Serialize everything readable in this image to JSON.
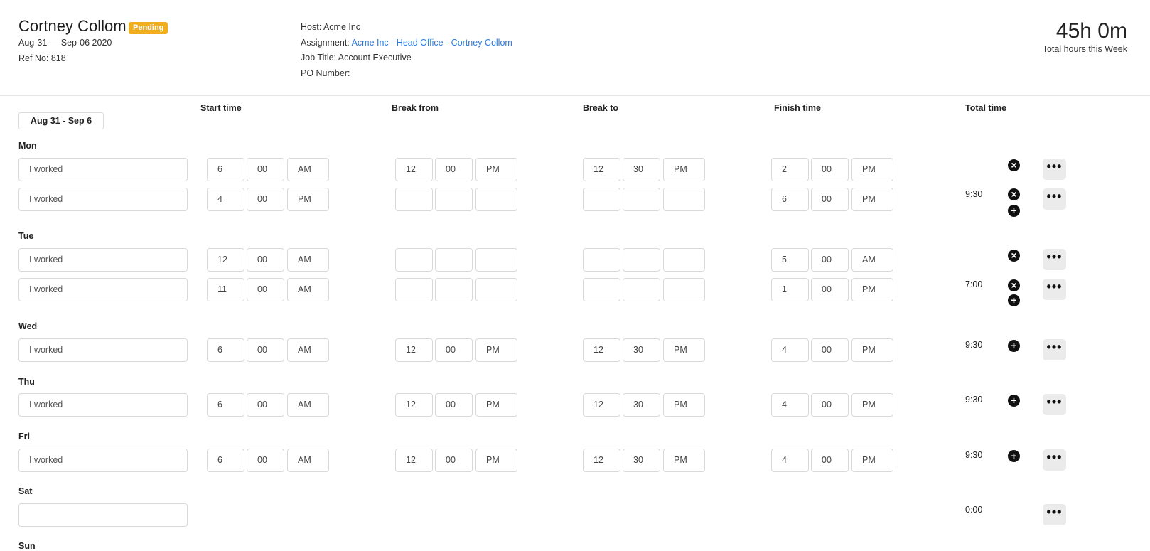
{
  "header": {
    "worker_name": "Cortney Collom",
    "status": "Pending",
    "date_range": "Aug-31 — Sep-06 2020",
    "ref": "Ref No: 818",
    "host": "Host: Acme Inc",
    "assignment_label": "Assignment: ",
    "assignment_link": "Acme Inc - Head Office - Cortney Collom",
    "job_title": "Job Title: Account Executive",
    "po_number": "PO Number:",
    "total_hours": "45h 0m",
    "total_hours_caption": "Total hours this Week"
  },
  "columns": {
    "start": "Start time",
    "break_from": "Break from",
    "break_to": "Break to",
    "finish": "Finish time",
    "total": "Total time"
  },
  "week_button": "Aug 31 - Sep 6",
  "colors": {
    "badge": "#f0ad1e",
    "link": "#2a7ae2"
  },
  "days": [
    {
      "label": "Mon",
      "total": "9:30",
      "rows": [
        {
          "desc": "I worked",
          "start": [
            "6",
            "00",
            "AM"
          ],
          "break_from": [
            "12",
            "00",
            "PM"
          ],
          "break_to": [
            "12",
            "30",
            "PM"
          ],
          "finish": [
            "2",
            "00",
            "PM"
          ]
        },
        {
          "desc": "I worked",
          "start": [
            "4",
            "00",
            "PM"
          ],
          "break_from": [
            "",
            "",
            ""
          ],
          "break_to": [
            "",
            "",
            ""
          ],
          "finish": [
            "6",
            "00",
            "PM"
          ]
        }
      ]
    },
    {
      "label": "Tue",
      "total": "7:00",
      "rows": [
        {
          "desc": "I worked",
          "start": [
            "12",
            "00",
            "AM"
          ],
          "break_from": [
            "",
            "",
            ""
          ],
          "break_to": [
            "",
            "",
            ""
          ],
          "finish": [
            "5",
            "00",
            "AM"
          ]
        },
        {
          "desc": "I worked",
          "start": [
            "11",
            "00",
            "AM"
          ],
          "break_from": [
            "",
            "",
            ""
          ],
          "break_to": [
            "",
            "",
            ""
          ],
          "finish": [
            "1",
            "00",
            "PM"
          ]
        }
      ]
    },
    {
      "label": "Wed",
      "total": "9:30",
      "rows": [
        {
          "desc": "I worked",
          "start": [
            "6",
            "00",
            "AM"
          ],
          "break_from": [
            "12",
            "00",
            "PM"
          ],
          "break_to": [
            "12",
            "30",
            "PM"
          ],
          "finish": [
            "4",
            "00",
            "PM"
          ]
        }
      ]
    },
    {
      "label": "Thu",
      "total": "9:30",
      "rows": [
        {
          "desc": "I worked",
          "start": [
            "6",
            "00",
            "AM"
          ],
          "break_from": [
            "12",
            "00",
            "PM"
          ],
          "break_to": [
            "12",
            "30",
            "PM"
          ],
          "finish": [
            "4",
            "00",
            "PM"
          ]
        }
      ]
    },
    {
      "label": "Fri",
      "total": "9:30",
      "rows": [
        {
          "desc": "I worked",
          "start": [
            "6",
            "00",
            "AM"
          ],
          "break_from": [
            "12",
            "00",
            "PM"
          ],
          "break_to": [
            "12",
            "30",
            "PM"
          ],
          "finish": [
            "4",
            "00",
            "PM"
          ]
        }
      ]
    },
    {
      "label": "Sat",
      "total": "0:00",
      "rows": [
        {
          "desc": ""
        }
      ]
    },
    {
      "label": "Sun"
    }
  ]
}
